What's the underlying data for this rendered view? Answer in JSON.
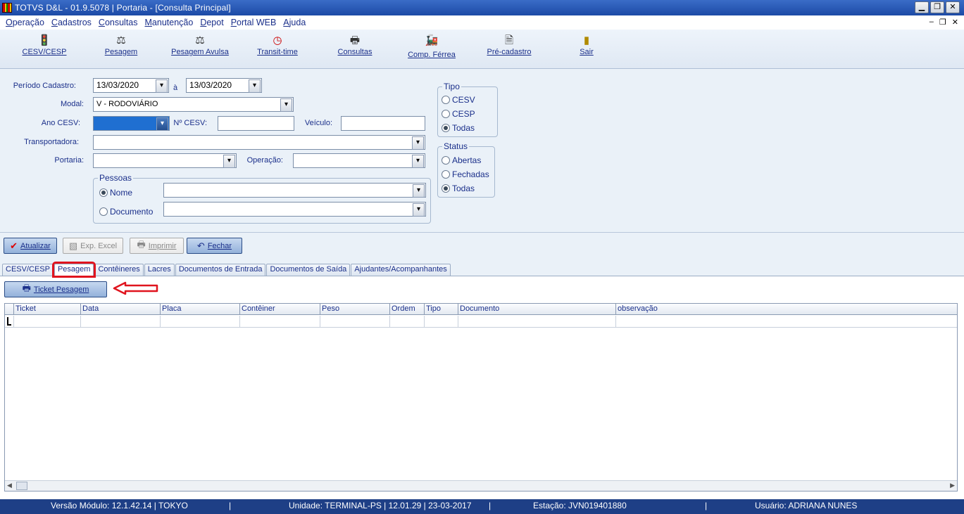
{
  "window": {
    "title": "TOTVS D&L - 01.9.5078 | Portaria - [Consulta Principal]"
  },
  "menu": [
    "Operação",
    "Cadastros",
    "Consultas",
    "Manutenção",
    "Depot",
    "Portal WEB",
    "Ajuda"
  ],
  "toolbar": [
    {
      "label": "CESV/CESP",
      "icon": "traffic-light-icon"
    },
    {
      "label": "Pesagem",
      "icon": "scale-icon"
    },
    {
      "label": "Pesagem Avulsa",
      "icon": "scale-icon"
    },
    {
      "label": "Transit-time",
      "icon": "clock-icon"
    },
    {
      "label": "Consultas",
      "icon": "printer-icon"
    },
    {
      "label": "Comp. Férrea",
      "icon": "train-icon"
    },
    {
      "label": "Pré-cadastro",
      "icon": "document-icon"
    },
    {
      "label": "Sair",
      "icon": "exit-door-icon"
    }
  ],
  "form": {
    "periodo_label": "Período Cadastro:",
    "date_from": "13/03/2020",
    "date_sep": "à",
    "date_to": "13/03/2020",
    "modal_label": "Modal:",
    "modal_value": "V - RODOVIÁRIO",
    "ano_label": "Ano CESV:",
    "ncesv_label": "Nº CESV:",
    "veiculo_label": "Veículo:",
    "transportadora_label": "Transportadora:",
    "portaria_label": "Portaria:",
    "operacao_label": "Operação:",
    "pessoas": {
      "title": "Pessoas",
      "nome": "Nome",
      "documento": "Documento",
      "selected": "Nome"
    }
  },
  "tipo": {
    "title": "Tipo",
    "options": [
      "CESV",
      "CESP",
      "Todas"
    ],
    "selected": "Todas"
  },
  "status": {
    "title": "Status",
    "options": [
      "Abertas",
      "Fechadas",
      "Todas"
    ],
    "selected": "Todas"
  },
  "actions": {
    "atualizar": "Atualizar",
    "excel": "Exp. Excel",
    "imprimir": "Imprimir",
    "fechar": "Fechar"
  },
  "tabs": [
    "CESV/CESP",
    "Pesagem",
    "Contêineres",
    "Lacres",
    "Documentos de Entrada",
    "Documentos de Saída",
    "Ajudantes/Acompanhantes"
  ],
  "active_tab": "Pesagem",
  "ticket_button": "Ticket Pesagem",
  "grid": {
    "columns": [
      "Ticket",
      "Data",
      "Placa",
      "Contêiner",
      "Peso",
      "Ordem",
      "Tipo",
      "Documento",
      "observação"
    ]
  },
  "statusbar": {
    "versao": "Versão Módulo:  12.1.42.14  |  TOKYO",
    "unidade": "Unidade: TERMINAL-PS | 12.01.29 | 23-03-2017",
    "estacao": "Estação: JVN019401880",
    "usuario": "Usuário: ADRIANA NUNES"
  },
  "colors": {
    "titlebar": "#1c4aa6",
    "statusbar": "#1e3f86",
    "highlight": "#e0141e",
    "selection": "#1f6fd1"
  }
}
